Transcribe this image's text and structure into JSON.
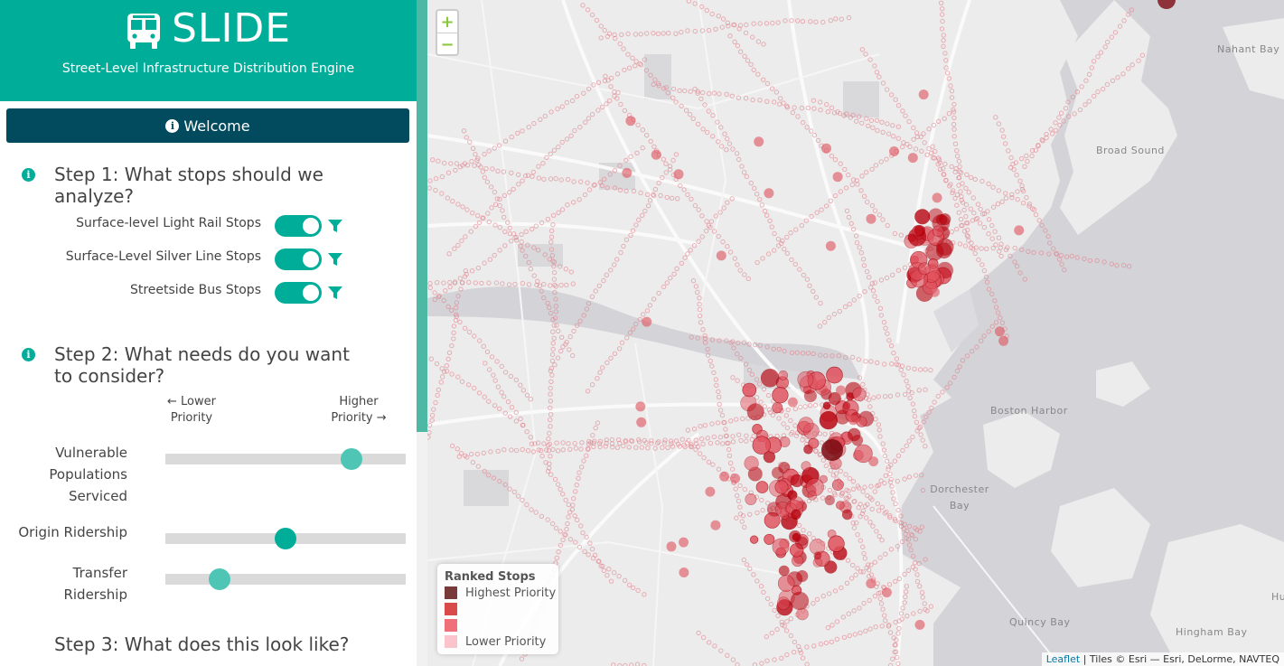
{
  "app": {
    "title": "SLIDE",
    "subtitle": "Street-Level Infrastructure Distribution Engine"
  },
  "welcome": {
    "label": "Welcome",
    "icon": "info-icon"
  },
  "step1": {
    "title": "Step 1: What stops should we analyze?",
    "toggles": [
      {
        "label": "Surface-level Light Rail Stops",
        "on": true
      },
      {
        "label": "Surface-Level Silver Line Stops",
        "on": true
      },
      {
        "label": "Streetside Bus Stops",
        "on": true
      }
    ]
  },
  "step2": {
    "title": "Step 2: What needs do you want to consider?",
    "lower_priority": "← Lower Priority",
    "higher_priority": "Higher Priority →",
    "sliders": [
      {
        "label": "Vulnerable Populations Serviced",
        "value": 0.8
      },
      {
        "label": "Origin Ridership",
        "value": 0.5
      },
      {
        "label": "Transfer Ridership",
        "value": 0.2
      }
    ]
  },
  "step3": {
    "title": "Step 3: What does this look like?"
  },
  "map": {
    "zoom_in": "+",
    "zoom_out": "−",
    "water_labels": [
      "Nahant Bay",
      "Broad Sound",
      "Boston Harbor",
      "Dorchester Bay",
      "Quincy Bay",
      "Hingham Bay",
      "Hu"
    ],
    "legend": {
      "title": "Ranked Stops",
      "highest": "Highest Priority",
      "lower": "Lower Priority",
      "colors": [
        "#7a3a3a",
        "#d94a4a",
        "#f0707a",
        "#fbc4cc"
      ]
    },
    "attribution": {
      "leaflet": "Leaflet",
      "rest": "| Tiles © Esri — Esri, DeLorme, NAVTEQ"
    }
  },
  "colors": {
    "brand": "#00ad99",
    "welcome_bg": "#024a5e",
    "thumb_light": "#4fc6b5",
    "thumb_dark": "#00ad99",
    "stop_dark": "#b8000c",
    "stop_light": "#e07a85"
  }
}
